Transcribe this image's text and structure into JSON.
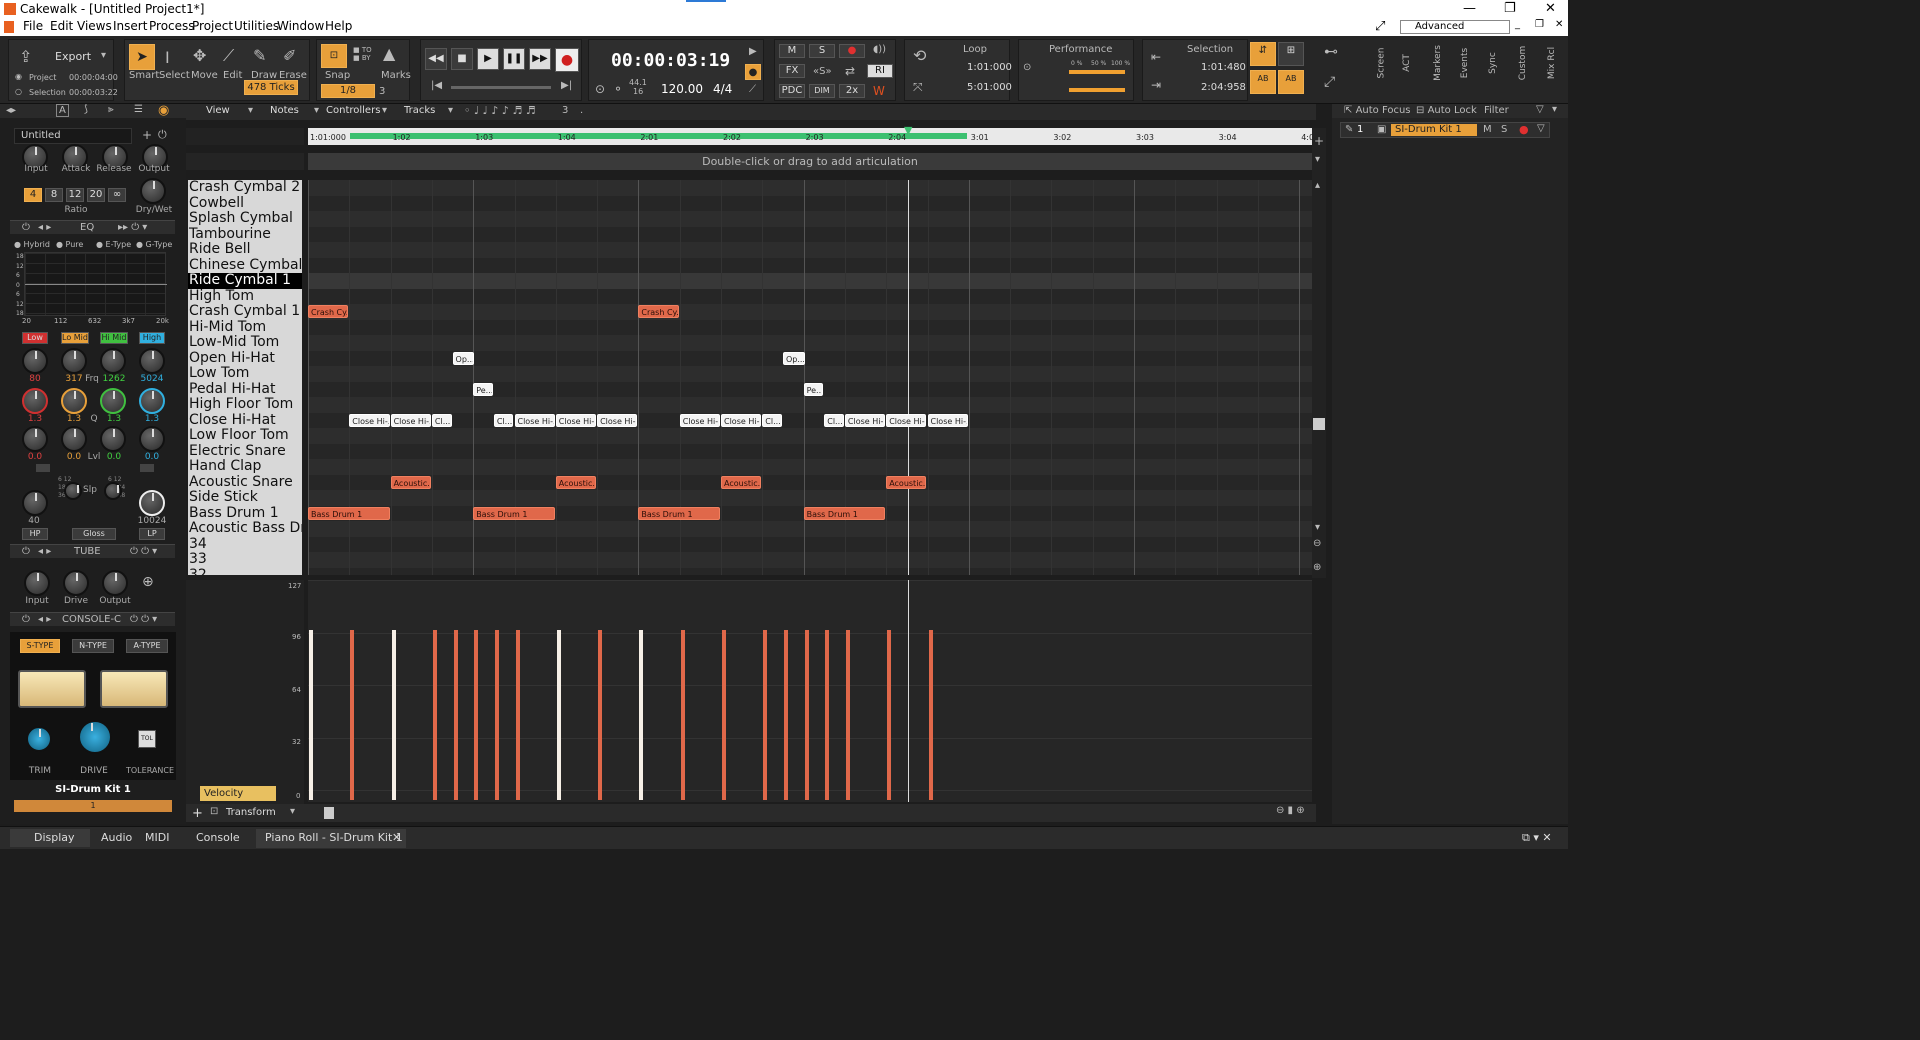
{
  "window": {
    "title": "Cakewalk - [Untitled Project1*]"
  },
  "menu": [
    "File",
    "Edit",
    "Views",
    "Insert",
    "Process",
    "Project",
    "Utilities",
    "Window",
    "Help"
  ],
  "workspace": "Advanced",
  "control_bar": {
    "export": "Export",
    "project": "Project",
    "project_time": "00:00:04:00",
    "selection": "Selection",
    "selection_time": "00:00:03:22",
    "tools": [
      "Smart",
      "Select",
      "Move",
      "Edit",
      "Draw",
      "Erase"
    ],
    "snap": "Snap",
    "marks": "Marks",
    "snap_value": "1/8",
    "snap_ticks": "478 Ticks",
    "snap_num": "3",
    "time": "00:00:03:19",
    "sample_rate": "44.1",
    "bit_depth": "16",
    "tempo": "120.00",
    "meter": "4/4",
    "mix": {
      "m": "M",
      "s": "S",
      "fx": "FX",
      "pdc": "PDC",
      "dim": "DIM",
      "x2": "2x",
      "ri": "RI"
    },
    "loop": {
      "label": "Loop",
      "start": "1:01:000",
      "end": "5:01:000"
    },
    "performance": {
      "label": "Performance",
      "cpu1": "0 %",
      "cpu2": "50 %",
      "cpu3": "100 %"
    },
    "selection_mod": {
      "label": "Selection",
      "start": "1:01:480",
      "end": "2:04:958"
    },
    "side_tabs": [
      "Screen",
      "ACT",
      "Markers",
      "Events",
      "Sync",
      "Custom",
      "Mix Rcl"
    ]
  },
  "pr_toolbar": {
    "view": "View",
    "notes": "Notes",
    "controllers": "Controllers",
    "tracks": "Tracks",
    "snap_num": "3"
  },
  "ruler": [
    "1:01:000",
    "1:02",
    "1:03",
    "1:04",
    "2:01",
    "2:02",
    "2:03",
    "2:04",
    "3:01",
    "3:02",
    "3:03",
    "3:04",
    "4:0"
  ],
  "articulation_hint": "Double-click or drag to add articulation",
  "drums": [
    "Crash Cymbal 2",
    "Cowbell",
    "Splash Cymbal",
    "Tambourine",
    "Ride Bell",
    "Chinese Cymbal",
    "Ride Cymbal 1",
    "High Tom",
    "Crash Cymbal 1",
    "Hi-Mid Tom",
    "Low-Mid Tom",
    "Open Hi-Hat",
    "Low Tom",
    "Pedal Hi-Hat",
    "High Floor Tom",
    "Close Hi-Hat",
    "Low Floor Tom",
    "Electric Snare",
    "Hand Clap",
    "Acoustic Snare",
    "Side Stick",
    "Bass Drum 1",
    "Acoustic Bass Dr",
    "34",
    "33",
    "32"
  ],
  "selected_drum": "Ride Cymbal 1",
  "notes": {
    "crash": "Crash Cy...",
    "open": "Op...",
    "pedal": "Pe...",
    "close": "Close Hi-...",
    "close_short": "Cl...",
    "snare": "Acoustic...",
    "bass": "Bass Drum 1"
  },
  "velocity": {
    "label": "Velocity",
    "ticks": [
      "127",
      "96",
      "64",
      "32",
      "0"
    ],
    "transform": "Transform"
  },
  "left_panel": {
    "track": "Untitled",
    "comp_knobs": [
      "Input",
      "Attack",
      "Release",
      "Output"
    ],
    "ratio": [
      "4",
      "8",
      "12",
      "20",
      "∞"
    ],
    "ratio_label": "Ratio",
    "drywet": "Dry/Wet",
    "eq": "EQ",
    "eq_modes": [
      "Hybrid",
      "Pure",
      "E-Type",
      "G-Type"
    ],
    "eq_db": [
      "18",
      "12",
      "6",
      "0",
      "6",
      "12",
      "18"
    ],
    "eq_freq": [
      "20",
      "112",
      "632",
      "3k7",
      "20k"
    ],
    "bands": [
      "Low",
      "Lo Mid",
      "Hi Mid",
      "High"
    ],
    "freqs": [
      "80",
      "317",
      "1262",
      "5024"
    ],
    "frq": "Frq",
    "qs": [
      "1.3",
      "1.3",
      "1.3",
      "1.3"
    ],
    "q": "Q",
    "lvls": [
      "0.0",
      "0.0",
      "0.0",
      "0.0"
    ],
    "lvl": "Lvl",
    "hp": "40",
    "lp": "10024",
    "hp_label": "HP",
    "gloss": "Gloss",
    "lp_label": "LP",
    "slp": "Slp",
    "slope_vals": [
      "6",
      "12",
      "18",
      "24",
      "36",
      "48"
    ],
    "tube": "TUBE",
    "tube_knobs": [
      "Input",
      "Drive",
      "Output"
    ],
    "console": "CONSOLE-C",
    "types": [
      "S-TYPE",
      "N-TYPE",
      "A-TYPE"
    ],
    "console_knobs": [
      "TRIM",
      "DRIVE",
      "TOLERANCE"
    ],
    "tol": "TOL",
    "kit": "SI-Drum Kit 1",
    "kit_num": "1"
  },
  "right_panel": {
    "auto_focus": "Auto Focus",
    "auto_lock": "Auto Lock",
    "filter": "Filter",
    "track_num": "1",
    "track_name": "SI-Drum Kit 1",
    "m": "M",
    "s": "S"
  },
  "bottom": {
    "display": "Display",
    "audio": "Audio",
    "midi": "MIDI",
    "console": "Console",
    "piano_roll": "Piano Roll - SI-Drum Kit 1"
  },
  "colors": {
    "note_red": "#e0684a",
    "accent": "#e8a03a",
    "playhead_green": "#3cc070"
  }
}
